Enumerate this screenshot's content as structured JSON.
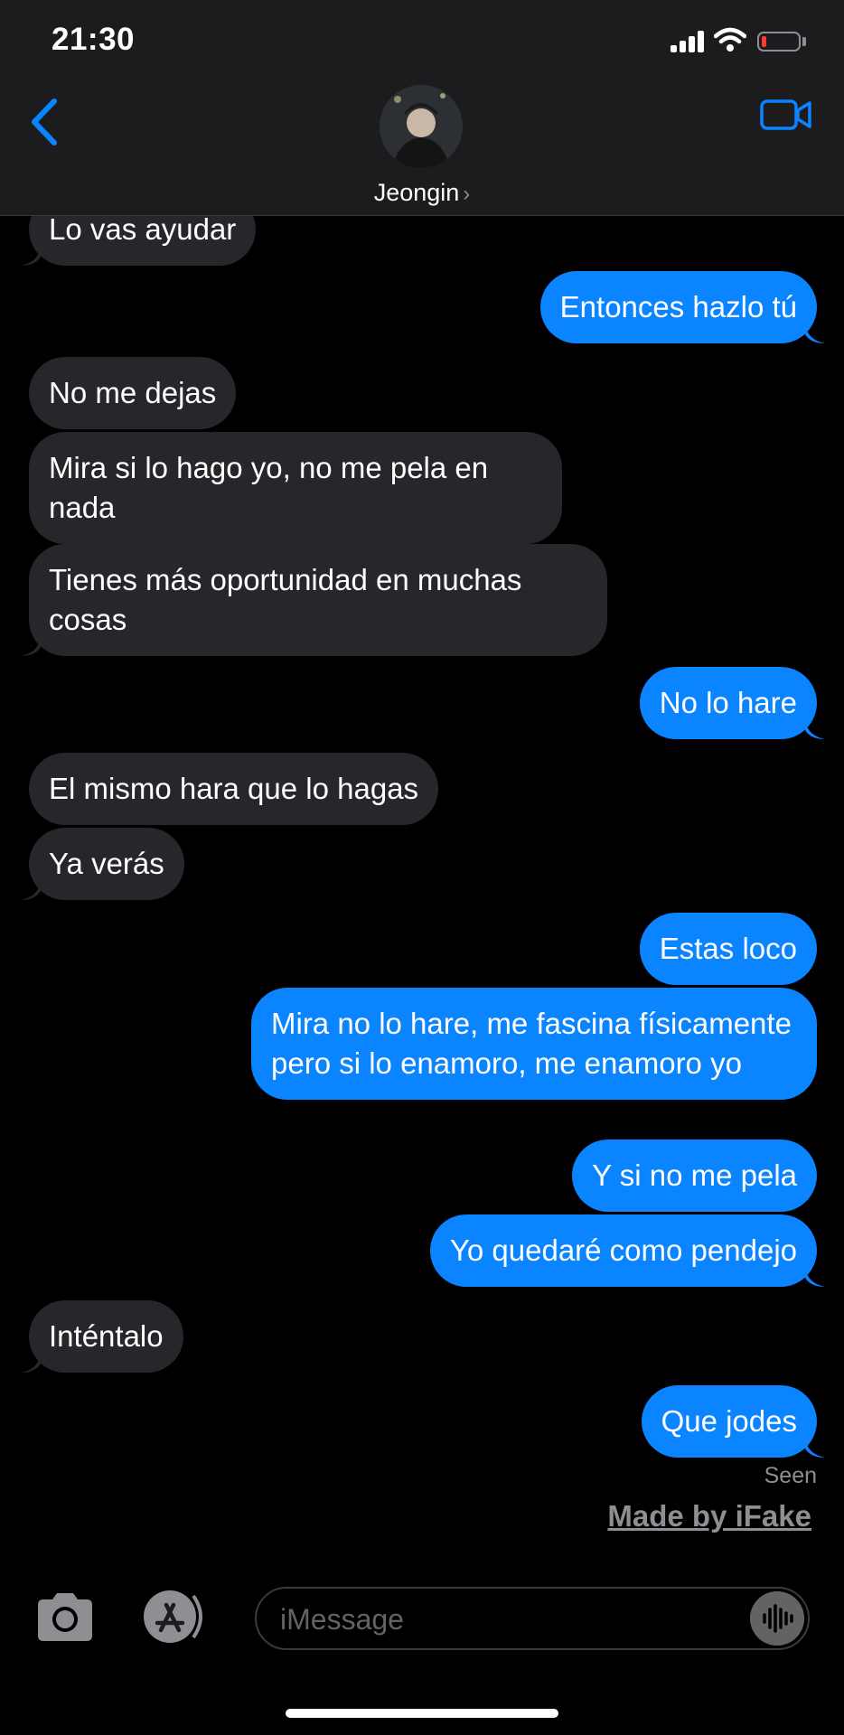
{
  "status_bar": {
    "time": "21:30"
  },
  "header": {
    "contact_name": "Jeongin"
  },
  "messages": [
    {
      "direction": "in",
      "text": "Lo vas ayudar"
    },
    {
      "direction": "out",
      "text": "Entonces hazlo tú"
    },
    {
      "direction": "in",
      "text": "No me dejas"
    },
    {
      "direction": "in",
      "text": "Mira si lo hago yo, no me pela en nada"
    },
    {
      "direction": "in",
      "text": "Tienes más oportunidad en muchas cosas"
    },
    {
      "direction": "out",
      "text": "No lo hare"
    },
    {
      "direction": "in",
      "text": "El mismo hara que lo hagas"
    },
    {
      "direction": "in",
      "text": "Ya verás"
    },
    {
      "direction": "out",
      "text": "Estas loco"
    },
    {
      "direction": "out",
      "text": "Mira no lo hare, me fascina físicamente pero si lo enamoro, me enamoro yo"
    },
    {
      "direction": "out",
      "text": "Y si no me pela"
    },
    {
      "direction": "out",
      "text": "Yo quedaré como pendejo"
    },
    {
      "direction": "in",
      "text": "Inténtalo"
    },
    {
      "direction": "out",
      "text": "Que jodes"
    }
  ],
  "read_receipt": "Seen",
  "watermark": "Made by iFake",
  "composer": {
    "placeholder": "iMessage"
  },
  "icons": {
    "back": "chevron-left-icon",
    "video": "video-camera-icon",
    "camera": "camera-icon",
    "appstore": "app-store-icon",
    "mic": "waveform-icon"
  },
  "colors": {
    "outgoing_bubble": "#0a84ff",
    "incoming_bubble": "#26272b",
    "accent": "#0a84ff",
    "background": "#000000"
  }
}
